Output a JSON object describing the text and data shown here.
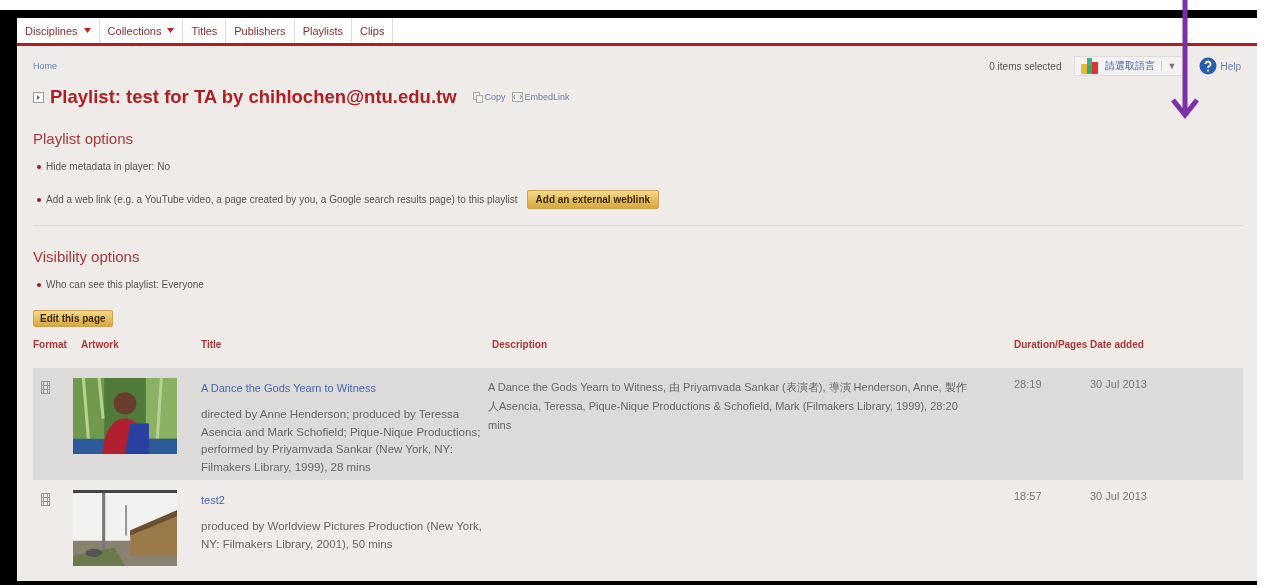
{
  "nav": [
    {
      "label": "Disciplines",
      "dropdown": true
    },
    {
      "label": "Collections",
      "dropdown": true
    },
    {
      "label": "Titles",
      "dropdown": false
    },
    {
      "label": "Publishers",
      "dropdown": false
    },
    {
      "label": "Playlists",
      "dropdown": false
    },
    {
      "label": "Clips",
      "dropdown": false
    }
  ],
  "breadcrumb": "Home",
  "toolbar": {
    "selected_count": "0 items selected",
    "language": "請選取語言",
    "language_caret": "▼",
    "help": "Help"
  },
  "title": {
    "text": "Playlist: test for TA by chihlochen@ntu.edu.tw",
    "copy": "Copy",
    "embed": "EmbedLink"
  },
  "sections": [
    {
      "heading": "Playlist options",
      "items": [
        {
          "text": "Hide metadata in player: No"
        },
        {
          "text": "Add a web link (e.g. a YouTube video, a page created by you, a Google search results page) to this playlist",
          "button": "Add an external weblink"
        }
      ]
    },
    {
      "heading": "Visibility options",
      "items": [
        {
          "text": "Who can see this playlist: Everyone"
        }
      ]
    }
  ],
  "edit_button": "Edit this page",
  "table": {
    "columns": [
      "Format",
      "Artwork",
      "Title",
      "Description",
      "Duration/Pages",
      "Date added"
    ],
    "rows": [
      {
        "highlighted": true,
        "title": "A Dance the Gods Yearn to Witness",
        "credits": "directed by Anne Henderson; produced by Teressa Asencia and Mark Schofield; Pique-Nique Productions; performed by Priyamvada Sankar (New York, NY: Filmakers Library, 1999), 28 mins",
        "description": "A Dance the Gods Yearn to Witness, 由 Priyamvada Sankar (表演者), 導演 Henderson, Anne, 製作人Asencia, Teressa, Pique-Nique Productions & Schofield, Mark (Filmakers Library, 1999), 28:20 mins",
        "duration": "28:19",
        "date": "30 Jul 2013"
      },
      {
        "highlighted": false,
        "title": "test2",
        "credits": "produced by Worldview Pictures Production (New York, NY: Filmakers Library, 2001), 50 mins",
        "description": "",
        "duration": "18:57",
        "date": "30 Jul 2013"
      }
    ]
  }
}
